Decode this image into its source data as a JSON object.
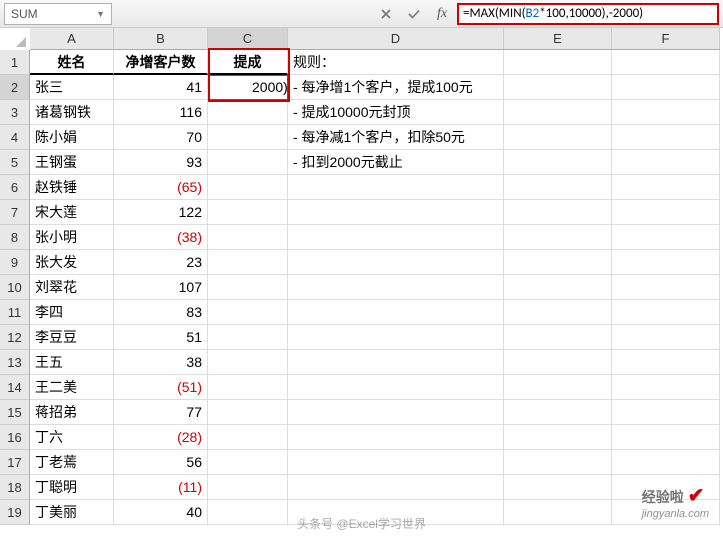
{
  "name_box": "SUM",
  "formula": {
    "prefix": "=MAX(MIN(",
    "ref": "B2",
    "suffix": "*100,10000),-2000)"
  },
  "columns": [
    "A",
    "B",
    "C",
    "D",
    "E",
    "F"
  ],
  "headers": {
    "name": "姓名",
    "net": "净增客户数",
    "bonus": "提成",
    "rules_title": "规则："
  },
  "active_cell_display": "2000)",
  "rules": [
    "- 每净增1个客户，提成100元",
    "- 提成10000元封顶",
    "- 每净减1个客户，扣除50元",
    "- 扣到2000元截止"
  ],
  "rows": [
    {
      "name": "张三",
      "net": "41",
      "neg": false
    },
    {
      "name": "诸葛钢铁",
      "net": "116",
      "neg": false
    },
    {
      "name": "陈小娟",
      "net": "70",
      "neg": false
    },
    {
      "name": "王钢蛋",
      "net": "93",
      "neg": false
    },
    {
      "name": "赵铁锤",
      "net": "(65)",
      "neg": true
    },
    {
      "name": "宋大莲",
      "net": "122",
      "neg": false
    },
    {
      "name": "张小明",
      "net": "(38)",
      "neg": true
    },
    {
      "name": "张大发",
      "net": "23",
      "neg": false
    },
    {
      "name": "刘翠花",
      "net": "107",
      "neg": false
    },
    {
      "name": "李四",
      "net": "83",
      "neg": false
    },
    {
      "name": "李豆豆",
      "net": "51",
      "neg": false
    },
    {
      "name": "王五",
      "net": "38",
      "neg": false
    },
    {
      "name": "王二美",
      "net": "(51)",
      "neg": true
    },
    {
      "name": "蒋招弟",
      "net": "77",
      "neg": false
    },
    {
      "name": "丁六",
      "net": "(28)",
      "neg": true
    },
    {
      "name": "丁老蔫",
      "net": "56",
      "neg": false
    },
    {
      "name": "丁聪明",
      "net": "(11)",
      "neg": true
    },
    {
      "name": "丁美丽",
      "net": "40",
      "neg": false
    }
  ],
  "watermark": {
    "main": "经验啦",
    "check": "✔",
    "sub": "jingyanla.com"
  },
  "author": "头条号 @Excel学习世界"
}
